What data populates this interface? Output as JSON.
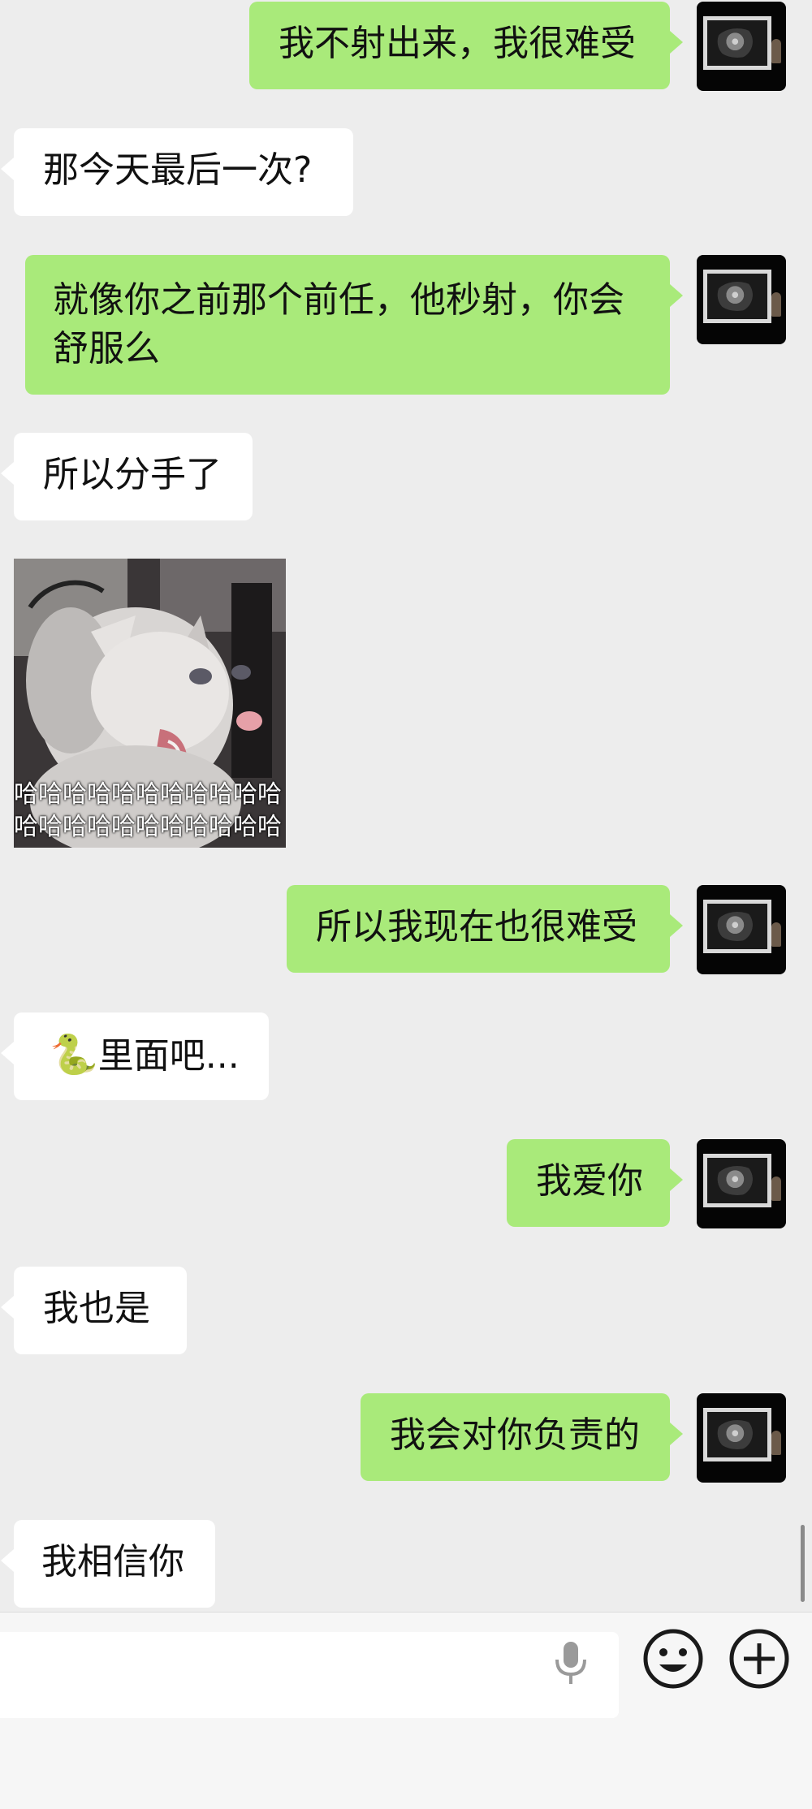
{
  "messages": [
    {
      "side": "out",
      "text": "我不射出来，我很难受"
    },
    {
      "side": "in",
      "text": "那今天最后一次?"
    },
    {
      "side": "out",
      "text": "就像你之前那个前任，他秒射，你会舒服么"
    },
    {
      "side": "in",
      "text": "所以分手了"
    },
    {
      "side": "in",
      "type": "sticker",
      "caption_line_1": "哈哈哈哈哈哈哈哈哈哈哈",
      "caption_line_2": "哈哈哈哈哈哈哈哈哈哈哈"
    },
    {
      "side": "out",
      "text": "所以我现在也很难受"
    },
    {
      "side": "in",
      "emoji": "🐍",
      "text": "里面吧..."
    },
    {
      "side": "out",
      "text": "我爱你"
    },
    {
      "side": "in",
      "text": "我也是"
    },
    {
      "side": "out",
      "text": "我会对你负责的"
    },
    {
      "side": "in",
      "text": "我相信你"
    }
  ],
  "input_bar": {
    "text_value": "",
    "icons": [
      "mic-icon",
      "emoji-icon",
      "plus-icon"
    ]
  },
  "colors": {
    "background": "#ededed",
    "outgoing_bubble": "#a9ea7a",
    "incoming_bubble": "#ffffff"
  }
}
